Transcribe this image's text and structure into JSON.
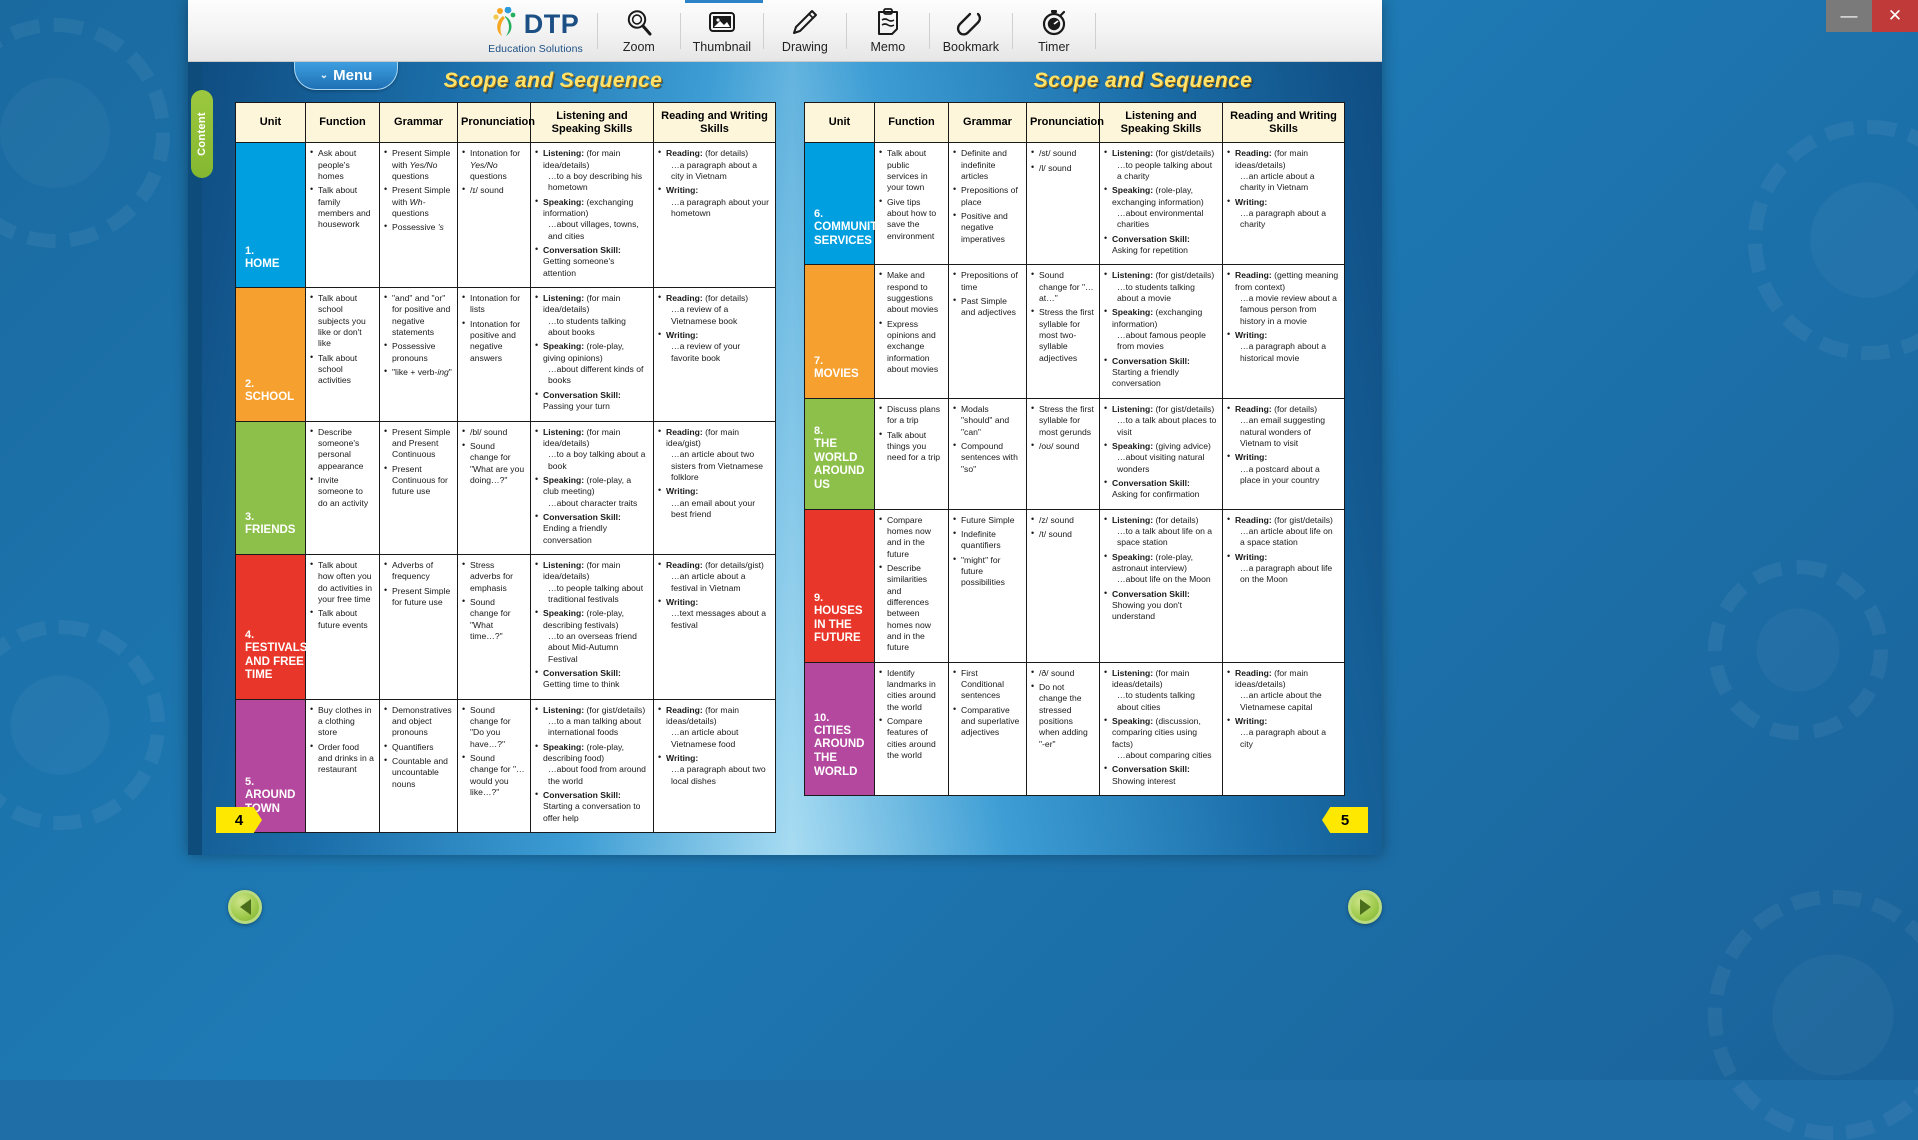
{
  "window": {
    "minimize_label": "—",
    "close_label": "✕"
  },
  "toolbar": {
    "brand_name": "DTP",
    "brand_sub": "Education Solutions",
    "tools": [
      {
        "label": "Zoom",
        "icon": "magnifier-icon"
      },
      {
        "label": "Thumbnail",
        "icon": "image-icon"
      },
      {
        "label": "Drawing",
        "icon": "pencil-icon"
      },
      {
        "label": "Memo",
        "icon": "clipboard-icon"
      },
      {
        "label": "Bookmark",
        "icon": "paperclip-icon"
      },
      {
        "label": "Timer",
        "icon": "stopwatch-icon"
      }
    ]
  },
  "viewer": {
    "content_tab_label": "Content",
    "menu_label": "Menu",
    "menu_chevron": "⌄",
    "prev_arrow": "◀",
    "next_arrow": "▶"
  },
  "columns": [
    "Unit",
    "Function",
    "Grammar",
    "Pronunciation",
    "Listening and Speaking Skills",
    "Reading and Writing Skills"
  ],
  "left_page": {
    "title": "Scope and Sequence",
    "page_number": "4",
    "rows": [
      {
        "unit_number": "1.",
        "unit_name": "HOME",
        "color": "#00a0e0",
        "function": [
          "Ask about people's homes",
          "Talk about family members and housework"
        ],
        "grammar": [
          "Present Simple with <i>Yes/No</i> questions",
          "Present Simple with <i>Wh-</i>questions",
          "Possessive <i>'s</i>"
        ],
        "pronunciation": [
          "Intonation for <i>Yes/No</i> questions",
          "/ɪ/ sound"
        ],
        "listening_speaking": [
          "<b>Listening:</b> (for main idea/details)<span class='sub'>…to a boy describing his hometown</span>",
          "<b>Speaking:</b> (exchanging information)<span class='sub'>…about villages, towns, and cities</span>",
          "<b>Conversation Skill:</b> Getting someone's attention"
        ],
        "reading_writing": [
          "<b>Reading:</b> (for details)<span class='sub'>…a paragraph about a city in Vietnam</span>",
          "<b>Writing:</b><span class='sub'>…a paragraph about your hometown</span>"
        ]
      },
      {
        "unit_number": "2.",
        "unit_name": "SCHOOL",
        "color": "#f6a030",
        "function": [
          "Talk about school subjects you like or don't like",
          "Talk about school activities"
        ],
        "grammar": [
          "\"and\" and \"or\" for positive and negative statements",
          "Possessive pronouns",
          "\"like + verb-<i>ing</i>\""
        ],
        "pronunciation": [
          "Intonation for lists",
          "Intonation for positive and negative answers"
        ],
        "listening_speaking": [
          "<b>Listening:</b> (for main idea/details)<span class='sub'>…to students talking about books</span>",
          "<b>Speaking:</b> (role-play, giving opinions)<span class='sub'>…about different kinds of books</span>",
          "<b>Conversation Skill:</b> Passing your turn"
        ],
        "reading_writing": [
          "<b>Reading:</b> (for details)<span class='sub'>…a review of a Vietnamese book</span>",
          "<b>Writing:</b><span class='sub'>…a review of your favorite book</span>"
        ]
      },
      {
        "unit_number": "3.",
        "unit_name": "FRIENDS",
        "color": "#8cc04a",
        "function": [
          "Describe someone's personal appearance",
          "Invite someone to do an activity"
        ],
        "grammar": [
          "Present Simple and Present Continuous",
          "Present Continuous for future use"
        ],
        "pronunciation": [
          "/bl/ sound",
          "Sound change for \"What are you doing…?\""
        ],
        "listening_speaking": [
          "<b>Listening:</b> (for main idea/details)<span class='sub'>…to a boy talking about a book</span>",
          "<b>Speaking:</b> (role-play, a club meeting)<span class='sub'>…about character traits</span>",
          "<b>Conversation Skill:</b> Ending a friendly conversation"
        ],
        "reading_writing": [
          "<b>Reading:</b> (for main idea/gist)<span class='sub'>…an article about two sisters from Vietnamese folklore</span>",
          "<b>Writing:</b><span class='sub'>…an email about your best friend</span>"
        ]
      },
      {
        "unit_number": "4.",
        "unit_name": "FESTIVALS AND FREE TIME",
        "color": "#e8372a",
        "function": [
          "Talk about how often you do activities in your free time",
          "Talk about future events"
        ],
        "grammar": [
          "Adverbs of frequency",
          "Present Simple for future use"
        ],
        "pronunciation": [
          "Stress adverbs for emphasis",
          "Sound change for \"What time…?\""
        ],
        "listening_speaking": [
          "<b>Listening:</b> (for main idea/details)<span class='sub'>…to people talking about traditional festivals</span>",
          "<b>Speaking:</b> (role-play, describing festivals)<span class='sub'>…to an overseas friend about Mid-Autumn Festival</span>",
          "<b>Conversation Skill:</b> Getting time to think"
        ],
        "reading_writing": [
          "<b>Reading:</b> (for details/gist)<span class='sub'>…an article about a festival in Vietnam</span>",
          "<b>Writing:</b><span class='sub'>…text messages about a festival</span>"
        ]
      },
      {
        "unit_number": "5.",
        "unit_name": "AROUND TOWN",
        "color": "#b4479e",
        "function": [
          "Buy clothes in a clothing store",
          "Order food and drinks in a restaurant"
        ],
        "grammar": [
          "Demonstratives and object pronouns",
          "Quantifiers",
          "Countable and uncountable nouns"
        ],
        "pronunciation": [
          "Sound change for \"Do you have…?\"",
          "Sound change for \"…would you like…?\""
        ],
        "listening_speaking": [
          "<b>Listening:</b> (for gist/details)<span class='sub'>…to a man talking about international foods</span>",
          "<b>Speaking:</b> (role-play, describing food)<span class='sub'>…about food from around the world</span>",
          "<b>Conversation Skill:</b> Starting a conversation to offer help"
        ],
        "reading_writing": [
          "<b>Reading:</b> (for main ideas/details)<span class='sub'>…an article about Vietnamese food</span>",
          "<b>Writing:</b><span class='sub'>…a paragraph about two local dishes</span>"
        ]
      }
    ]
  },
  "right_page": {
    "title": "Scope and Sequence",
    "page_number": "5",
    "rows": [
      {
        "unit_number": "6.",
        "unit_name": "COMMUNITY SERVICES",
        "color": "#00a0e0",
        "function": [
          "Talk about public services in your town",
          "Give tips about how to save the environment"
        ],
        "grammar": [
          "Definite and indefinite articles",
          "Prepositions of place",
          "Positive and negative imperatives"
        ],
        "pronunciation": [
          "/st/ sound",
          "/l/ sound"
        ],
        "listening_speaking": [
          "<b>Listening:</b> (for gist/details)<span class='sub'>…to people talking about a charity</span>",
          "<b>Speaking:</b> (role-play, exchanging information)<span class='sub'>…about environmental charities</span>",
          "<b>Conversation Skill:</b> Asking for repetition"
        ],
        "reading_writing": [
          "<b>Reading:</b> (for main ideas/details)<span class='sub'>…an article about a charity in Vietnam</span>",
          "<b>Writing:</b><span class='sub'>…a paragraph about a charity</span>"
        ]
      },
      {
        "unit_number": "7.",
        "unit_name": "MOVIES",
        "color": "#f6a030",
        "function": [
          "Make and respond to suggestions about movies",
          "Express opinions and exchange information about movies"
        ],
        "grammar": [
          "Prepositions of time",
          "Past Simple and adjectives"
        ],
        "pronunciation": [
          "Sound change for \"…at…\"",
          "Stress the first syllable for most two-syllable adjectives"
        ],
        "listening_speaking": [
          "<b>Listening:</b> (for gist/details)<span class='sub'>…to students talking about a movie</span>",
          "<b>Speaking:</b> (exchanging information)<span class='sub'>…about famous people from movies</span>",
          "<b>Conversation Skill:</b> Starting a friendly conversation"
        ],
        "reading_writing": [
          "<b>Reading:</b> (getting meaning from context)<span class='sub'>…a movie review about a famous person from history in a movie</span>",
          "<b>Writing:</b><span class='sub'>…a paragraph about a historical movie</span>"
        ]
      },
      {
        "unit_number": "8.",
        "unit_name": "THE WORLD AROUND US",
        "color": "#8cc04a",
        "function": [
          "Discuss plans for a trip",
          "Talk about things you need for a trip"
        ],
        "grammar": [
          "Modals \"should\" and \"can\"",
          "Compound sentences with \"so\""
        ],
        "pronunciation": [
          "Stress the first syllable for most gerunds",
          "/oʊ/ sound"
        ],
        "listening_speaking": [
          "<b>Listening:</b> (for gist/details)<span class='sub'>…to a talk about places to visit</span>",
          "<b>Speaking:</b> (giving advice)<span class='sub'>…about visiting natural wonders</span>",
          "<b>Conversation Skill:</b> Asking for confirmation"
        ],
        "reading_writing": [
          "<b>Reading:</b> (for details)<span class='sub'>…an email suggesting natural wonders of Vietnam to visit</span>",
          "<b>Writing:</b><span class='sub'>…a postcard about a place in your country</span>"
        ]
      },
      {
        "unit_number": "9.",
        "unit_name": "HOUSES IN THE FUTURE",
        "color": "#e8372a",
        "function": [
          "Compare homes now and in the future",
          "Describe similarities and differences between homes now and in the future"
        ],
        "grammar": [
          "Future Simple",
          "Indefinite quantifiers",
          "\"might\" for future possibilities"
        ],
        "pronunciation": [
          "/z/ sound",
          "/t/ sound"
        ],
        "listening_speaking": [
          "<b>Listening:</b> (for details)<span class='sub'>…to a talk about life on a space station</span>",
          "<b>Speaking:</b> (role-play, astronaut interview)<span class='sub'>…about life on the Moon</span>",
          "<b>Conversation Skill:</b> Showing you don't understand"
        ],
        "reading_writing": [
          "<b>Reading:</b> (for gist/details)<span class='sub'>…an article about life on a space station</span>",
          "<b>Writing:</b><span class='sub'>…a paragraph about life on the Moon</span>"
        ]
      },
      {
        "unit_number": "10.",
        "unit_name": "CITIES AROUND THE WORLD",
        "color": "#b4479e",
        "function": [
          "Identify landmarks in cities around the world",
          "Compare features of cities around the world"
        ],
        "grammar": [
          "First Conditional sentences",
          "Comparative and superlative adjectives"
        ],
        "pronunciation": [
          "/ð/ sound",
          "Do not change the stressed positions when adding \"-er\""
        ],
        "listening_speaking": [
          "<b>Listening:</b> (for main ideas/details)<span class='sub'>…to students talking about cities</span>",
          "<b>Speaking:</b> (discussion, comparing cities using facts)<span class='sub'>…about comparing cities</span>",
          "<b>Conversation Skill:</b> Showing interest"
        ],
        "reading_writing": [
          "<b>Reading:</b> (for main ideas/details)<span class='sub'>…an article about the Vietnamese capital</span>",
          "<b>Writing:</b><span class='sub'>…a paragraph about a city</span>"
        ]
      }
    ]
  }
}
